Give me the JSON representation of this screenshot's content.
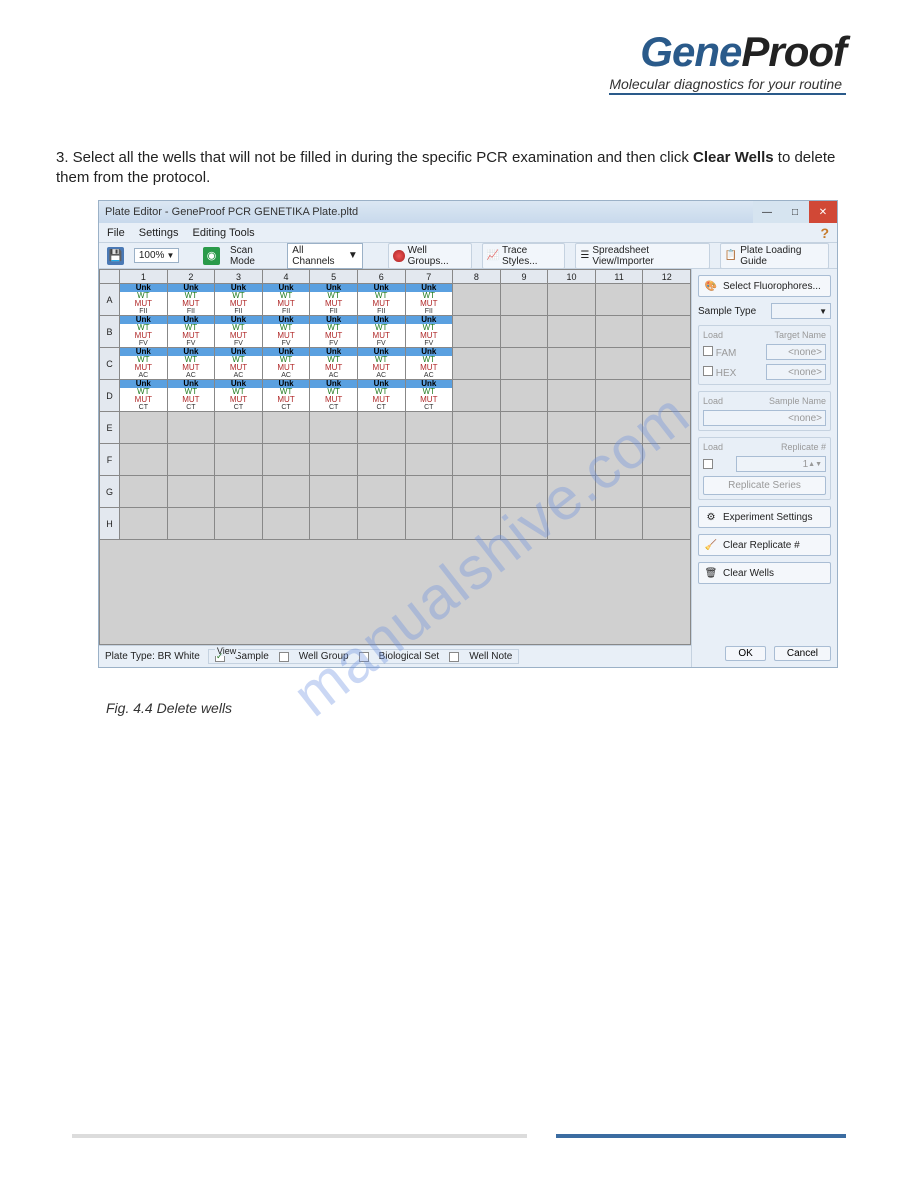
{
  "logo": {
    "part1": "Gene",
    "part2": "Proof",
    "sub": "Molecular diagnostics for your routine"
  },
  "instruction": "3. Select all the wells that will not be filled in during the specific PCR examination and then click Clear Wells to delete them from the protocol.",
  "caption": "Fig. 4.4 Delete wells",
  "watermark": "manualshive.com",
  "app": {
    "title": "Plate Editor - GeneProof PCR GENETIKA Plate.pltd",
    "menu": {
      "file": "File",
      "settings": "Settings",
      "editing": "Editing Tools",
      "help": "?"
    },
    "toolbar": {
      "zoom": "100%",
      "scan_label": "Scan Mode",
      "scan_sel": "All Channels",
      "well_groups": "Well Groups...",
      "trace_styles": "Trace Styles...",
      "spreadsheet": "Spreadsheet View/Importer",
      "plate_loading": "Plate Loading Guide"
    },
    "plate": {
      "cols": [
        "1",
        "2",
        "3",
        "4",
        "5",
        "6",
        "7",
        "8",
        "9",
        "10",
        "11",
        "12"
      ],
      "rows": [
        "A",
        "B",
        "C",
        "D",
        "E",
        "F",
        "G",
        "H"
      ],
      "well_label_unk": "Unk",
      "well_line1": "WT",
      "well_line2": "MUT",
      "row_genes": {
        "A": "FII",
        "B": "FV",
        "C": "AC",
        "D": "CT"
      },
      "filled_cols": 7,
      "filled_rows": [
        "A",
        "B",
        "C",
        "D"
      ]
    },
    "status": {
      "plate_type": "Plate Type: BR White",
      "view_label": "View",
      "chk_sample": "Sample",
      "chk_wellgroup": "Well Group",
      "chk_bioset": "Biological Set",
      "chk_wellnote": "Well Note"
    },
    "side": {
      "select_fluor": "Select Fluorophores...",
      "sample_type": "Sample Type",
      "load": "Load",
      "target_name": "Target Name",
      "fam": "FAM",
      "hex": "HEX",
      "none": "<none>",
      "sample_name": "Sample Name",
      "replicate_num": "Replicate #",
      "replicate_series": "Replicate Series",
      "experiment_settings": "Experiment Settings",
      "clear_replicate": "Clear Replicate #",
      "clear_wells": "Clear Wells",
      "replicate_val": "1",
      "ok": "OK",
      "cancel": "Cancel"
    }
  }
}
